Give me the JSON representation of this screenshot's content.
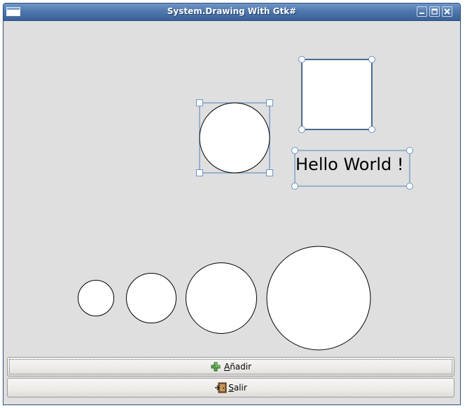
{
  "window": {
    "title": "System.Drawing With Gtk#"
  },
  "title_buttons": {
    "minimize_icon": "minimize-icon",
    "maximize_icon": "maximize-icon",
    "close_icon": "close-icon"
  },
  "canvas": {
    "text_label": "Hello World !"
  },
  "buttons": {
    "add": {
      "mnemonic": "A",
      "rest": "ñadir",
      "icon": "add-icon"
    },
    "quit": {
      "mnemonic": "S",
      "rest": "alir",
      "icon": "exit-icon"
    }
  },
  "colors": {
    "titlebar": "#4f78ad",
    "background": "#dfdfdf",
    "selection_handle": "#7ea0c8",
    "shape_fill": "#ffffff",
    "shape_stroke": "#000000"
  }
}
